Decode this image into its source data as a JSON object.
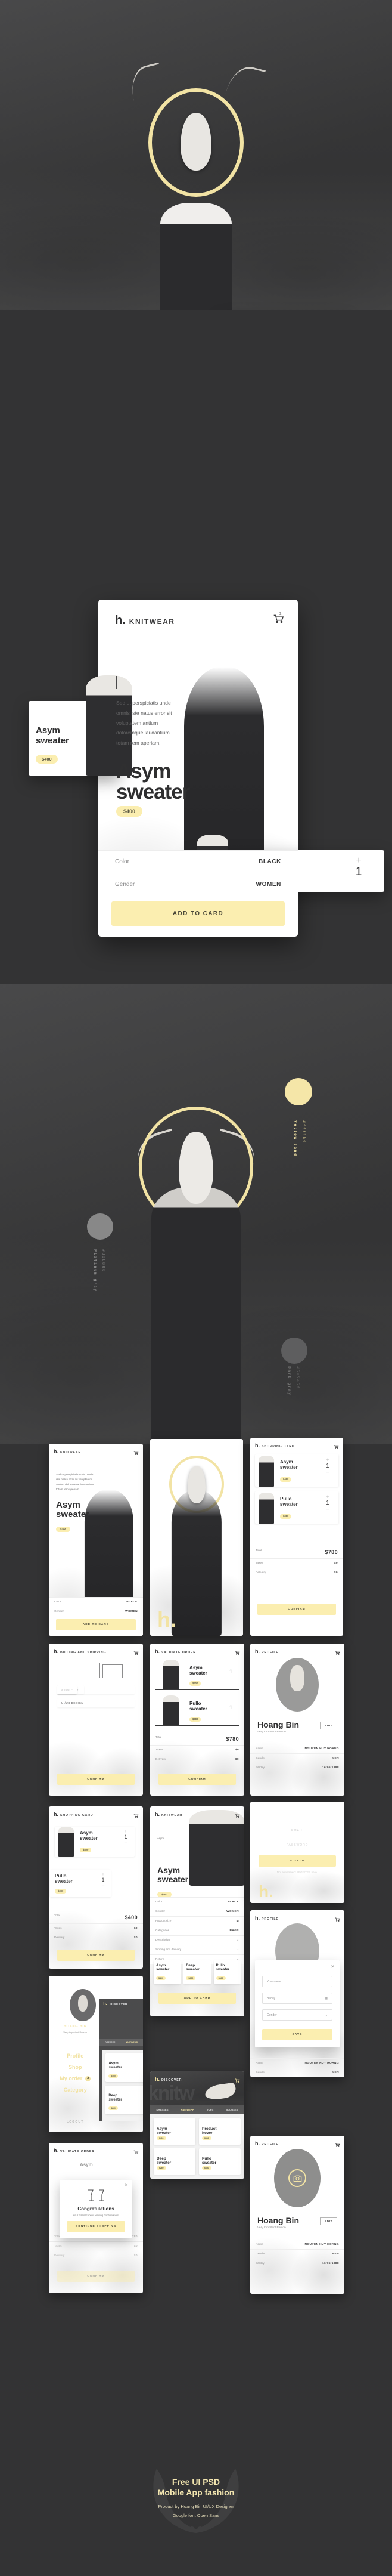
{
  "brand": {
    "mark": "h.",
    "dot": "."
  },
  "hero": {
    "alt": "Woman with deer skull and gold halo over mountain landscape"
  },
  "screens": {
    "knitwear": {
      "brand": "h.",
      "section": "KNITWEAR",
      "cart_count": "2",
      "lorem": "Sed ut perspiciatis unde omnis iste natus error sit voluptatem antium doloremque laudantium totam rem aperiam.",
      "title_line1": "Asym",
      "title_line2": "sweater",
      "price": "$400",
      "rows": [
        {
          "label": "Color",
          "value": "BLACK"
        },
        {
          "label": "Gender",
          "value": "WOMEN"
        }
      ],
      "cta": "ADD TO CARD"
    },
    "menu": {
      "user_name": "HOANG BIN",
      "user_role": "Very Important Person",
      "items": [
        {
          "label": "Profile",
          "badge": ""
        },
        {
          "label": "Shop",
          "badge": ""
        },
        {
          "label": "My order",
          "badge": "2"
        },
        {
          "label": "Category",
          "badge": ""
        }
      ],
      "logout": "LOGOUT"
    },
    "discover": {
      "brand": "h.",
      "section": "DISCOVER",
      "watermark": "knitw",
      "cart_count": "2",
      "tabs": [
        {
          "label": "DRESSES",
          "active": false
        },
        {
          "label": "KNITWEAR",
          "active": true
        },
        {
          "label": "TOPS",
          "active": false
        },
        {
          "label": "BLOUSES",
          "active": false
        }
      ],
      "products": [
        {
          "name_line1": "Asym",
          "name_line2": "sweater",
          "price": "$400"
        },
        {
          "name_line1": "Product",
          "name_line2": "hover",
          "price": "$380"
        },
        {
          "name_line1": "Deep",
          "name_line2": "sweater",
          "price": "$260"
        },
        {
          "name_line1": "Pullo",
          "name_line2": "sweater",
          "price": "$380"
        }
      ]
    },
    "shopping_card": {
      "brand": "h.",
      "section": "SHOPPING CARD",
      "items": [
        {
          "name_line1": "Asym",
          "name_line2": "sweater",
          "price": "$400",
          "qty": "1"
        },
        {
          "name_line1": "Pullo",
          "name_line2": "sweater",
          "price": "$380",
          "qty": "1"
        }
      ],
      "totals": [
        {
          "label": "Total",
          "value": "$780"
        },
        {
          "label": "Taxes",
          "value": "$0"
        },
        {
          "label": "Delivery",
          "value": "$0"
        }
      ],
      "cta": "CONFIRM"
    },
    "shopping_card_single": {
      "brand": "h.",
      "section": "SHOPPING CARD",
      "items": [
        {
          "name_line1": "Asym",
          "name_line2": "sweater",
          "price": "$400",
          "qty": "1"
        },
        {
          "name_line1": "Pullo",
          "name_line2": "sweater",
          "price": "$380",
          "qty": "1"
        }
      ],
      "totals": [
        {
          "label": "Total",
          "value": "$400"
        },
        {
          "label": "Taxes",
          "value": "$0"
        },
        {
          "label": "Delivery",
          "value": "$0"
        }
      ],
      "cta": "CONFIRM"
    },
    "billing": {
      "brand": "h.",
      "section": "BILLING AND SHIPPING",
      "fields": [
        {
          "value": "HOANG BIN",
          "placeholder": ""
        },
        {
          "value": "UI/UX DESIGN",
          "placeholder": ""
        },
        {
          "value": "",
          "placeholder": "VAT Number"
        },
        {
          "value": "",
          "placeholder": "Email *"
        },
        {
          "value": "",
          "placeholder": "Phone *"
        },
        {
          "value": "",
          "placeholder": "Street *"
        }
      ],
      "cta": "CONFIRM"
    },
    "validate_order": {
      "brand": "h.",
      "section": "VALIDATE ORDER",
      "items": [
        {
          "name_line1": "Asym",
          "name_line2": "sweater",
          "price": "$400",
          "qty": "1"
        },
        {
          "name_line1": "Pullo",
          "name_line2": "sweater",
          "price": "$380",
          "qty": "1"
        }
      ],
      "totals": [
        {
          "label": "Total",
          "value": "$780"
        },
        {
          "label": "Taxes",
          "value": "$0"
        },
        {
          "label": "Delivery",
          "value": "$0"
        }
      ],
      "cta": "CONFIRM"
    },
    "profile": {
      "brand": "h.",
      "section": "PROFILE",
      "name": "Hoang Bin",
      "role": "Very Important Person",
      "edit": "EDIT",
      "rows": [
        {
          "label": "Name",
          "value": "NGUYEN HUY HOANG"
        },
        {
          "label": "Gender",
          "value": "MEN"
        },
        {
          "label": "Bitrday",
          "value": "16/05/1988"
        }
      ]
    },
    "profile_edit": {
      "brand": "h.",
      "section": "PROFILE",
      "close": "✕",
      "fields": [
        {
          "placeholder": "Your name",
          "icon": ""
        },
        {
          "placeholder": "Birday",
          "icon": "calendar-icon"
        },
        {
          "placeholder": "Gender",
          "icon": "chevron-down-icon"
        }
      ],
      "cta": "SAVE"
    },
    "login": {
      "brand": "h.",
      "email_placeholder": "EMAIL",
      "password_placeholder": "PASSWORD",
      "cta": "SIGN IN",
      "register_text": "Not a member? REGISTER here."
    },
    "product_detail": {
      "brand": "h.",
      "section": "KNITWEAR",
      "title_line1": "Asym",
      "title_line2": "sweater",
      "price": "$400",
      "rows": [
        {
          "label": "Color",
          "value": "BLACK"
        },
        {
          "label": "Gender",
          "value": "WOMEN"
        },
        {
          "label": "Product size",
          "value": "M"
        },
        {
          "label": "Categories",
          "value": "BAGS"
        }
      ],
      "accordions": [
        {
          "label": "Description"
        },
        {
          "label": "Sipping and delivery"
        },
        {
          "label": "Return"
        }
      ],
      "related": [
        {
          "name_line1": "Asym",
          "name_line2": "sweater",
          "price": "$400"
        },
        {
          "name_line1": "Deep",
          "name_line2": "sweater",
          "price": "$260"
        },
        {
          "name_line1": "Pullo",
          "name_line2": "sweater",
          "price": "$380"
        }
      ],
      "cta": "ADD TO CARD"
    },
    "congrats": {
      "close": "✕",
      "title": "Congratulations",
      "message": "Your transaction is waiting confirmation!",
      "cta": "CONTINUE SHOPPING"
    },
    "profile_photo": {
      "brand": "h.",
      "section": "PROFILE",
      "name": "Hoang Bin",
      "role": "Very Important Person",
      "edit": "EDIT",
      "camera_icon": "camera-icon",
      "rows": [
        {
          "label": "Name",
          "value": "NGUYEN HUY HOANG"
        },
        {
          "label": "Gender",
          "value": "MEN"
        },
        {
          "label": "Bitrday",
          "value": "16/05/1988"
        }
      ]
    },
    "splash": {
      "brand": "h."
    }
  },
  "palette": [
    {
      "name": "Yellow sand",
      "hex": "#fff1b9",
      "swatch": "#f5e6a8"
    },
    {
      "name": "Platinum gray",
      "hex": "#888888",
      "swatch": "#888888"
    },
    {
      "name": "Dark gray",
      "hex": "#5e5e5f",
      "swatch": "#5e5e5f"
    }
  ],
  "footer": {
    "title_line1": "Free UI PSD",
    "title_line2": "Mobile App fashion",
    "credit": "Product by Hoang Bin UI/UX Designer",
    "font_note": "Google font Open Sans"
  }
}
